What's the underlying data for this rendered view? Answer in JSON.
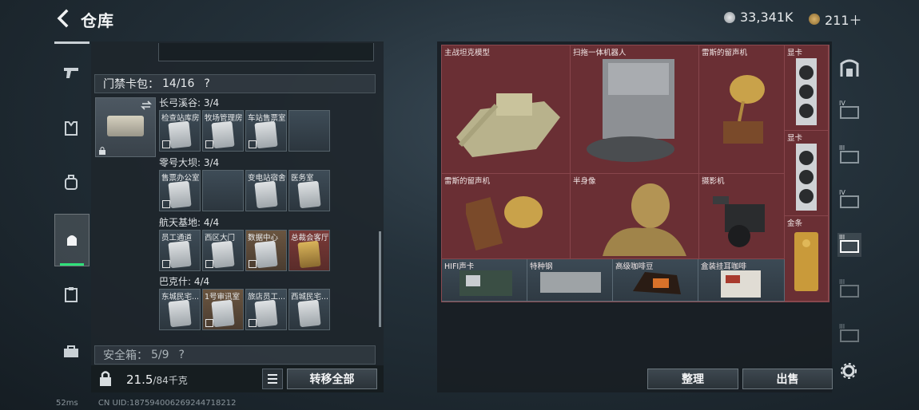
{
  "header": {
    "title": "仓库",
    "currency1": "33,341K",
    "currency2": "211＋"
  },
  "left": {
    "card_pack": {
      "label": "门禁卡包：",
      "count": "14/16",
      "help": "?"
    },
    "groups": [
      {
        "name": "长弓溪谷: 3/4",
        "slots": [
          {
            "label": "检查站库房"
          },
          {
            "label": "牧场管理房"
          },
          {
            "label": "车站售票室"
          },
          {
            "label": ""
          }
        ]
      },
      {
        "name": "零号大坝: 3/4",
        "slots": [
          {
            "label": "售票办公室"
          },
          {
            "label": ""
          },
          {
            "label": "变电站宿舍"
          },
          {
            "label": "医务室"
          }
        ]
      },
      {
        "name": "航天基地: 4/4",
        "slots": [
          {
            "label": "员工通道"
          },
          {
            "label": "西区大门"
          },
          {
            "label": "数据中心"
          },
          {
            "label": "总裁会客厅"
          }
        ]
      },
      {
        "name": "巴克什: 4/4",
        "slots": [
          {
            "label": "东城民宅..."
          },
          {
            "label": "1号审讯室"
          },
          {
            "label": "旅店员工..."
          },
          {
            "label": "西城民宅..."
          }
        ]
      }
    ],
    "safe_box": {
      "label": "安全箱：",
      "count": "5/9",
      "help": "?"
    },
    "weight": {
      "current": "21.5",
      "max": "/84千克"
    },
    "transfer_all": "转移全部"
  },
  "right": {
    "items": [
      {
        "label": "主战坦克模型"
      },
      {
        "label": "扫拖一体机器人"
      },
      {
        "label": "雷斯的留声机"
      },
      {
        "label": "显卡"
      },
      {
        "label": "显卡"
      },
      {
        "label": "雷斯的留声机"
      },
      {
        "label": "半身像"
      },
      {
        "label": "摄影机"
      },
      {
        "label": "金条"
      },
      {
        "label": "HIFI声卡"
      },
      {
        "label": "特种钢"
      },
      {
        "label": "高级咖啡豆"
      },
      {
        "label": "盒装挂耳咖啡"
      }
    ],
    "sort_button": "整理",
    "sell_button": "出售",
    "side_tabs": [
      "IV",
      "III",
      "IV",
      "III",
      "III",
      "III"
    ]
  },
  "status": {
    "ping": "52ms",
    "uid": "CN UID:18759400626924471821​2"
  },
  "colors": {
    "accent_green": "#2fe07a",
    "item_bg": "#6a2f34"
  }
}
